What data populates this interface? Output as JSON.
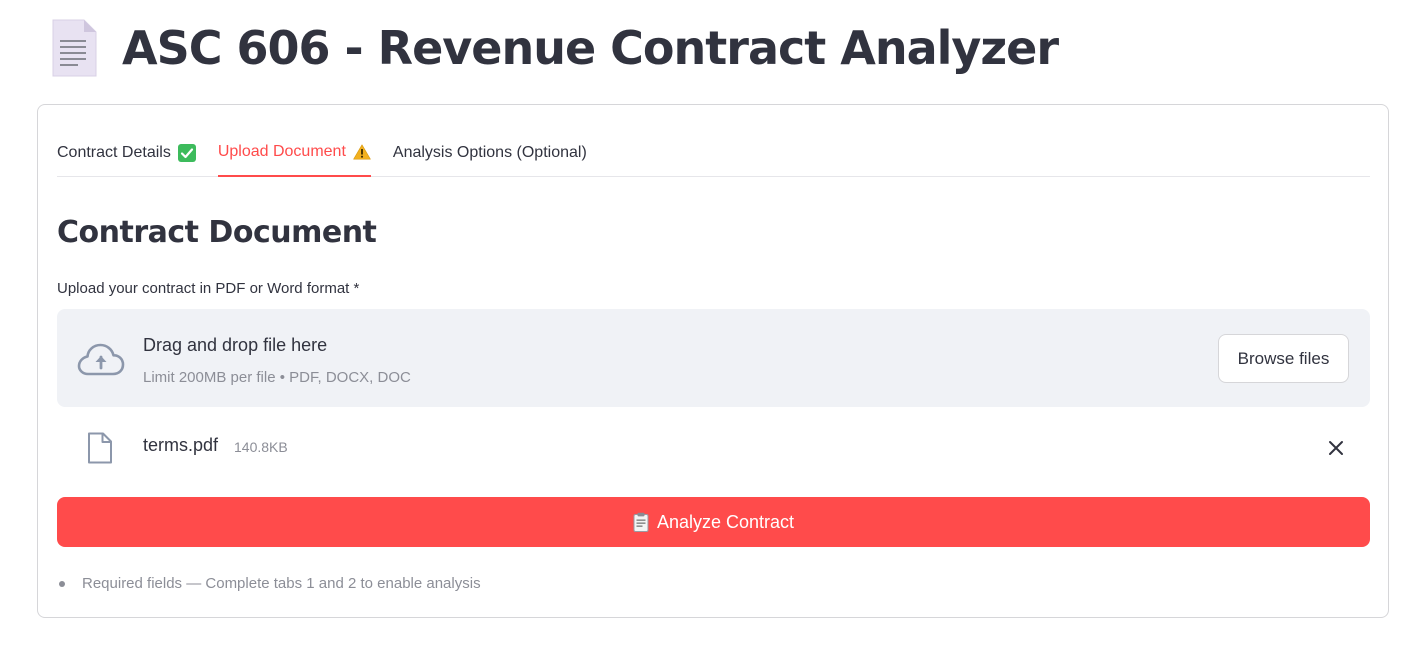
{
  "app": {
    "title": "ASC 606 - Revenue Contract Analyzer",
    "title_icon": "document-icon"
  },
  "tabs": [
    {
      "label": "Contract Details",
      "status_icon": "check-mark-icon",
      "active": false
    },
    {
      "label": "Upload Document",
      "status_icon": "warning-icon",
      "active": true
    },
    {
      "label": "Analysis Options (Optional)",
      "status_icon": null,
      "active": false
    }
  ],
  "section": {
    "title": "Contract Document"
  },
  "uploader": {
    "label": "Upload your contract in PDF or Word format *",
    "dropzone_title": "Drag and drop file here",
    "dropzone_limits": "Limit 200MB per file • PDF, DOCX, DOC",
    "browse_label": "Browse files",
    "file": {
      "name": "terms.pdf",
      "size": "140.8KB"
    }
  },
  "analyze_button": {
    "label": "Analyze Contract",
    "icon": "clipboard-icon"
  },
  "footer_note": "Required fields — Complete tabs 1 and 2 to enable analysis",
  "colors": {
    "accent": "#ff4b4b",
    "success": "#3dbb5c",
    "warning": "#f2b01e",
    "text": "#31333f",
    "muted": "#8c8e97",
    "dropzone_bg": "#f0f2f6"
  }
}
